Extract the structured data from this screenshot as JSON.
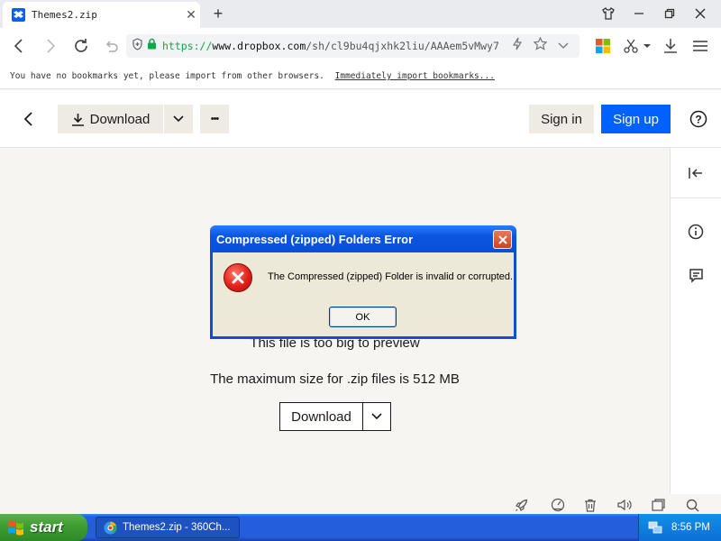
{
  "browser": {
    "tab_title": "Themes2.zip",
    "new_tab_glyph": "+",
    "url_scheme": "https://",
    "url_host": "www.dropbox.com",
    "url_path": "/sh/cl9bu4qjxhk2liu/AAAem5vMwy7",
    "bookmarks_message": "You have no bookmarks yet, please import from other browsers.",
    "bookmarks_link": "Immediately import bookmarks..."
  },
  "header": {
    "download_label": "Download",
    "sign_in_label": "Sign in",
    "sign_up_label": "Sign up",
    "more_glyph": "•••",
    "help_glyph": "?"
  },
  "content": {
    "preview_message": "This file is too big to preview",
    "size_message": "The maximum size for .zip files is 512 MB",
    "download_label": "Download"
  },
  "dialog": {
    "title": "Compressed (zipped) Folders Error",
    "message": "The Compressed (zipped) Folder is invalid or corrupted.",
    "ok_label": "OK"
  },
  "taskbar": {
    "start_label": "start",
    "task_label": "Themes2.zip - 360Ch...",
    "clock": "8:56 PM"
  },
  "colors": {
    "dropbox_blue": "#0061fe",
    "xp_title_blue": "#0a4fd6",
    "xp_start_green": "#3c9a31",
    "error_red": "#e0201a"
  },
  "icons": [
    "dropbox-favicon",
    "back-icon",
    "forward-icon",
    "reload-icon",
    "undo-icon",
    "shield-icon",
    "lock-icon",
    "lightning-icon",
    "star-icon",
    "chevron-down-icon",
    "apps-icon",
    "scissors-icon",
    "download-icon",
    "menu-icon",
    "chevron-left-icon",
    "ellipsis-icon",
    "help-icon",
    "collapse-panel-icon",
    "info-icon",
    "comment-icon",
    "rocket-icon",
    "speed-icon",
    "trash-icon",
    "volume-icon",
    "window-icon",
    "search-icon",
    "error-icon",
    "windows-logo-icon",
    "browser-360-icon",
    "network-icon"
  ]
}
